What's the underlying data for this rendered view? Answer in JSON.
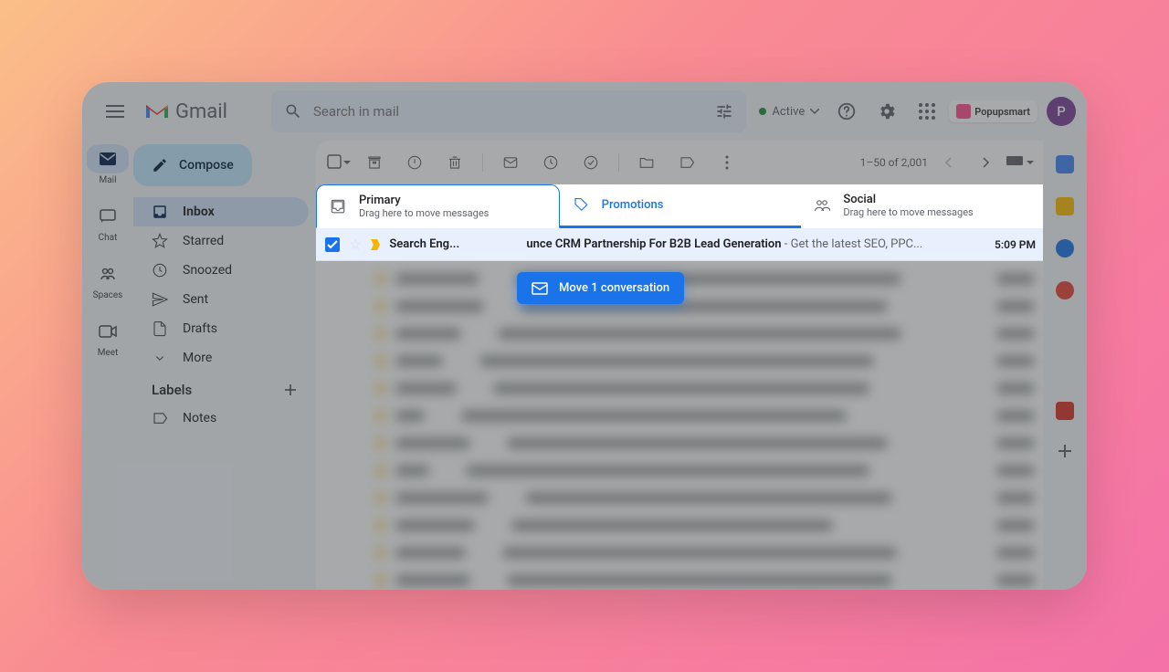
{
  "header": {
    "app_name": "Gmail",
    "search_placeholder": "Search in mail",
    "status": "Active",
    "ext_name": "Popupsmart",
    "avatar_letter": "P"
  },
  "rail": [
    {
      "label": "Mail"
    },
    {
      "label": "Chat"
    },
    {
      "label": "Spaces"
    },
    {
      "label": "Meet"
    }
  ],
  "sidebar": {
    "compose": "Compose",
    "items": [
      {
        "label": "Inbox"
      },
      {
        "label": "Starred"
      },
      {
        "label": "Snoozed"
      },
      {
        "label": "Sent"
      },
      {
        "label": "Drafts"
      },
      {
        "label": "More"
      }
    ],
    "labels_header": "Labels",
    "labels": [
      {
        "label": "Notes"
      }
    ]
  },
  "toolbar": {
    "pagination": "1–50 of 2,001"
  },
  "tabs": [
    {
      "title": "Primary",
      "sub": "Drag here to move messages"
    },
    {
      "title": "Promotions",
      "sub": ""
    },
    {
      "title": "Social",
      "sub": "Drag here to move messages"
    }
  ],
  "email": {
    "sender": "Search Eng...",
    "subject": "unce CRM Partnership For B2B Lead Generation",
    "preview": " - Get the latest SEO, PPC...",
    "time": "5:09 PM"
  },
  "drag_tip": "Move 1 conversation"
}
